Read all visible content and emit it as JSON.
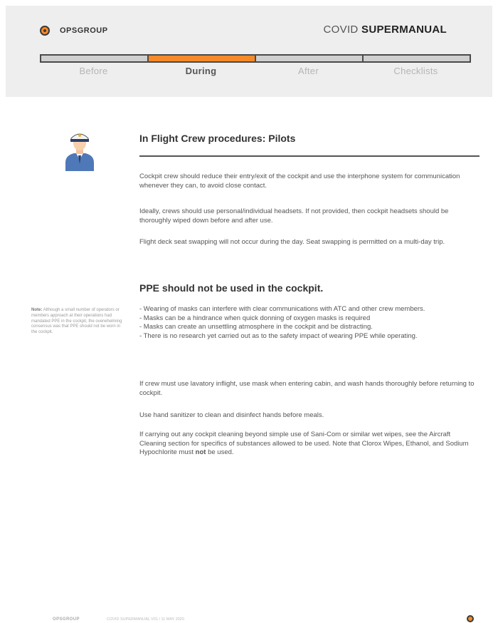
{
  "header": {
    "brand": "OPSGROUP",
    "title_light": "COVID ",
    "title_bold": "SUPERMANUAL",
    "progress_active_index": 1,
    "tabs": [
      {
        "label": "Before"
      },
      {
        "label": "During"
      },
      {
        "label": "After"
      },
      {
        "label": "Checklists"
      }
    ],
    "accent_color": "#f58a2a"
  },
  "section1": {
    "icon": "pilot-icon",
    "heading": "In Flight Crew procedures: Pilots",
    "paragraphs": [
      "Cockpit crew should reduce their entry/exit of the cockpit and use the interphone system for communication whenever they can, to avoid close contact.",
      "Ideally, crews should use personal/individual headsets. If not provided, then cockpit headsets should be thoroughly wiped down before and after use.",
      "Flight deck seat swapping will not occur during the day. Seat swapping is permitted on a multi-day trip."
    ]
  },
  "section2": {
    "heading": "PPE should not be used in the cockpit.",
    "note_label": "Note:",
    "note_text": "Although a small number of operators or members approach at their operations had mandated PPE in the cockpit, the overwhelming consensus was that PPE should not be worn in the cockpit.",
    "bullets": [
      "- Wearing of masks can interfere with clear communications with ATC and other crew members.",
      "- Masks can be a hindrance when quick donning of oxygen masks is required",
      "- Masks can create an unsettling atmosphere in the cockpit and be distracting.",
      "- There is no research yet carried out as to the safety impact of wearing PPE while operating."
    ],
    "paragraphs": [
      "If crew must use lavatory inflight, use mask when entering cabin, and wash hands thoroughly before returning to cockpit.",
      "Use hand sanitizer to clean and disinfect hands before meals.",
      "If carrying out any cockpit cleaning beyond simple use of Sani-Com or similar wet wipes, see the Aircraft Cleaning section for specifics of substances allowed to be used. Note that Clorox Wipes, Ethanol, and Sodium Hypochlorite must "
    ],
    "emphasis": "not",
    "tail": " be used."
  },
  "footer": {
    "brand": "OPSGROUP",
    "text": "COVID SUPERMANUAL V01 / 11 MAY 2020"
  }
}
